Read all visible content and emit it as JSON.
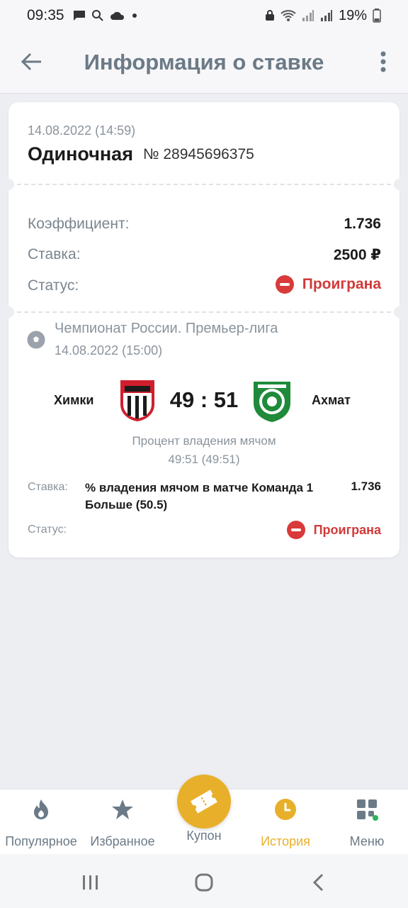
{
  "status_bar": {
    "time": "09:35",
    "battery": "19%"
  },
  "header": {
    "title": "Информация о ставке"
  },
  "bet": {
    "date": "14.08.2022 (14:59)",
    "type": "Одиночная",
    "number": "№ 28945696375",
    "coefficient_label": "Коэффициент:",
    "coefficient_value": "1.736",
    "stake_label": "Ставка:",
    "stake_value": "2500 ₽",
    "status_label": "Статус:",
    "status_value": "Проиграна"
  },
  "event": {
    "league": "Чемпионат России. Премьер-лига",
    "date": "14.08.2022 (15:00)",
    "home_team": "Химки",
    "away_team": "Ахмат",
    "score": "49 : 51",
    "market": "Процент владения мячом",
    "market_score": "49:51 (49:51)",
    "stake_label": "Ставка:",
    "stake_desc": "% владения мячом в матче Команда 1 Больше (50.5)",
    "stake_odds": "1.736",
    "status_label": "Статус:",
    "status_value": "Проиграна"
  },
  "bottom_nav": {
    "items": [
      {
        "label": "Популярное",
        "icon": "fire-icon"
      },
      {
        "label": "Избранное",
        "icon": "star-icon"
      },
      {
        "label": "Купон",
        "icon": "ticket-icon"
      },
      {
        "label": "История",
        "icon": "clock-icon"
      },
      {
        "label": "Меню",
        "icon": "grid-icon"
      }
    ]
  },
  "colors": {
    "accent": "#e8b02a",
    "lost": "#d23a3a",
    "muted": "#8a939c"
  }
}
